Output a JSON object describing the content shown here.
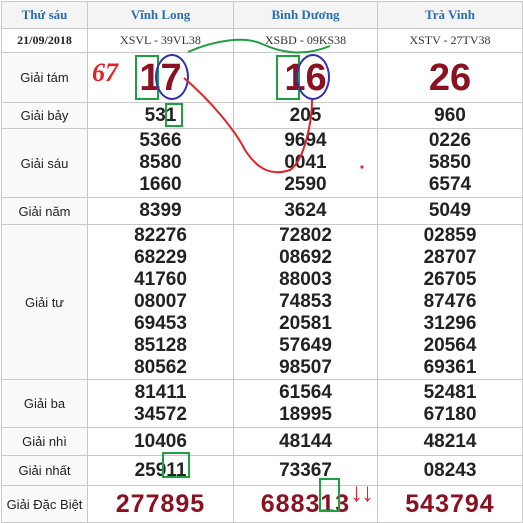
{
  "header": {
    "day": "Thứ sáu",
    "date": "21/09/2018"
  },
  "provinces": [
    {
      "name": "Vĩnh Long",
      "code": "XSVL - 39VL38"
    },
    {
      "name": "Bình Dương",
      "code": "XSBD - 09KS38"
    },
    {
      "name": "Trà Vinh",
      "code": "XSTV - 27TV38"
    }
  ],
  "prizes": {
    "g8": {
      "label": "Giải tám",
      "values": [
        "17",
        "16",
        "26"
      ]
    },
    "g7": {
      "label": "Giải bảy",
      "values": [
        "531",
        "205",
        "960"
      ]
    },
    "g6": {
      "label": "Giải sáu",
      "values": [
        [
          "5366",
          "8580",
          "1660"
        ],
        [
          "9694",
          "0041",
          "2590"
        ],
        [
          "0226",
          "5850",
          "6574"
        ]
      ]
    },
    "g5": {
      "label": "Giải năm",
      "values": [
        "8399",
        "3624",
        "5049"
      ]
    },
    "g4": {
      "label": "Giải tư",
      "values": [
        [
          "82276",
          "68229",
          "41760",
          "08007",
          "69453",
          "85128",
          "80562"
        ],
        [
          "72802",
          "08692",
          "88003",
          "74853",
          "20581",
          "57649",
          "98507"
        ],
        [
          "02859",
          "28707",
          "26705",
          "87476",
          "31296",
          "20564",
          "69361"
        ]
      ]
    },
    "g3": {
      "label": "Giải ba",
      "values": [
        [
          "81411",
          "34572"
        ],
        [
          "61564",
          "18995"
        ],
        [
          "52481",
          "67180"
        ]
      ]
    },
    "g2": {
      "label": "Giải nhì",
      "values": [
        "10406",
        "48144",
        "48214"
      ]
    },
    "g1": {
      "label": "Giải nhất",
      "values": [
        "25911",
        "73367",
        "08243"
      ]
    },
    "db": {
      "label": "Giải Đặc Biệt",
      "values": [
        "277895",
        "688313",
        "543794"
      ]
    }
  },
  "annotations": {
    "handwritten": "67",
    "arrows": "↓↓",
    "colors": {
      "red": "#e0242a",
      "green": "#1fa040",
      "blue": "#3030b0",
      "prize": "#8b1020"
    }
  }
}
